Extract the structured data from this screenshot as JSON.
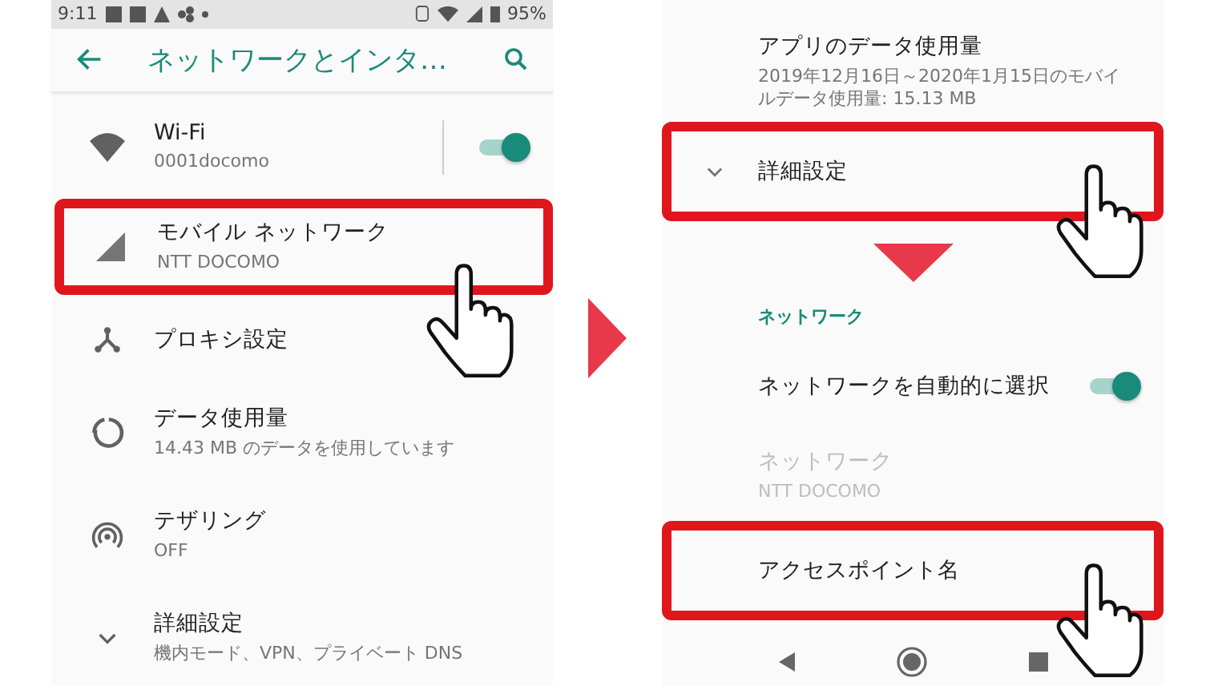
{
  "left_screen": {
    "status_bar": {
      "time": "9:11",
      "battery": "95%"
    },
    "app_bar": {
      "title": "ネットワークとインタ…"
    },
    "items": [
      {
        "kind": "toggle",
        "title": "Wi-Fi",
        "subtitle": "0001docomo",
        "on": true,
        "highlighted": false
      },
      {
        "kind": "plain",
        "title": "モバイル ネットワーク",
        "subtitle": "NTT DOCOMO",
        "highlighted": true
      },
      {
        "kind": "plain",
        "title": "プロキシ設定",
        "highlighted": false
      },
      {
        "kind": "plain",
        "title": "データ使用量",
        "subtitle": "14.43 MB のデータを使用しています",
        "highlighted": false
      },
      {
        "kind": "plain",
        "title": "テザリング",
        "subtitle": "OFF",
        "highlighted": false
      },
      {
        "kind": "plain",
        "title": "詳細設定",
        "subtitle": "機内モード、VPN、プライベート DNS",
        "highlighted": false
      }
    ]
  },
  "right_screen": {
    "items": [
      {
        "kind": "plain",
        "title": "アプリのデータ使用量",
        "subtitle": "2019年12月16日～2020年1月15日のモバイルデータ使用量: 15.13 MB",
        "highlighted": false,
        "disabled": false
      },
      {
        "kind": "expander",
        "title": "詳細設定",
        "highlighted": true,
        "disabled": false
      },
      {
        "kind": "step-arrow"
      },
      {
        "kind": "header",
        "title": "ネットワーク"
      },
      {
        "kind": "toggle",
        "title": "ネットワークを自動的に選択",
        "on": true,
        "highlighted": false,
        "disabled": false
      },
      {
        "kind": "plain",
        "title": "ネットワーク",
        "subtitle": "NTT DOCOMO",
        "highlighted": false,
        "disabled": true
      },
      {
        "kind": "plain",
        "title": "アクセスポイント名",
        "highlighted": true,
        "disabled": false
      }
    ]
  }
}
